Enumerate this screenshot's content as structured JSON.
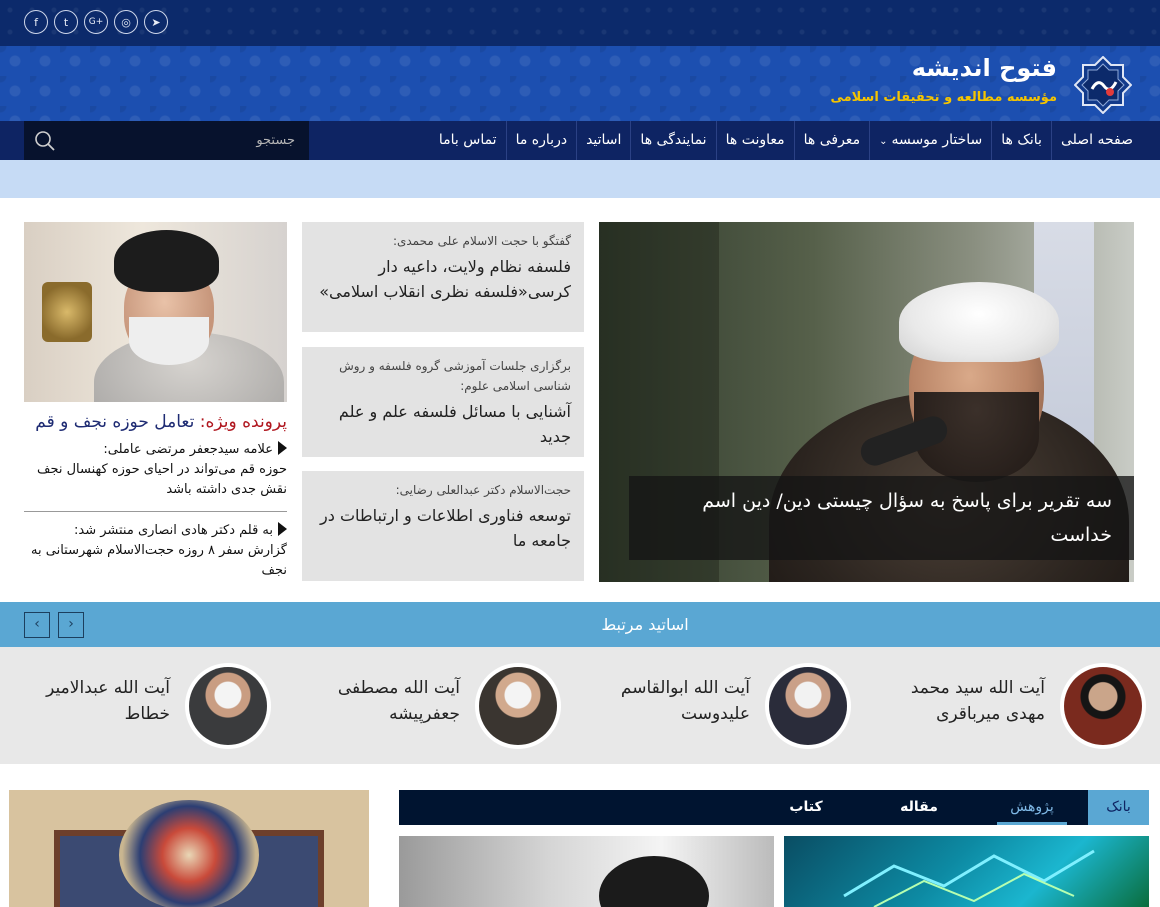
{
  "social": [
    {
      "name": "facebook-icon",
      "glyph": "f"
    },
    {
      "name": "twitter-icon",
      "glyph": "t"
    },
    {
      "name": "googleplus-icon",
      "glyph": "G+"
    },
    {
      "name": "instagram-icon",
      "glyph": "◎"
    },
    {
      "name": "telegram-icon",
      "glyph": "➤"
    }
  ],
  "header": {
    "title": "فتوح اندیشه",
    "subtitle": "مؤسسه مطالعه و تحقیقات اسلامی"
  },
  "nav": {
    "items": [
      "صفحه اصلی",
      "بانک ها",
      "ساختار موسسه",
      "معرفی ها",
      "معاونت ها",
      "نمایندگی ها",
      "اساتید",
      "درباره ما",
      "تماس باما"
    ],
    "search_placeholder": "جستجو"
  },
  "hero": {
    "caption": "سه تقریر برای پاسخ به سؤال چیستی دین/ دین اسم خداست"
  },
  "news": [
    {
      "kicker": "گفتگو با حجت الاسلام علی محمدی:",
      "title": "فلسفه نظام ولایت، داعیه دار کرسی«فلسفه نظری انقلاب اسلامی»"
    },
    {
      "kicker": "برگزاری جلسات آموزشی گروه فلسفه و روش شناسی اسلامی علوم:",
      "title": "آشنایی با مسائل فلسفه علم و علم جدید"
    },
    {
      "kicker": "حجت‌الاسلام دکتر عبدالعلی رضایی:",
      "title": "توسعه فناوری اطلاعات و ارتباطات در جامعه ما"
    }
  ],
  "special": {
    "label": "پرونده ویژه:",
    "title": "تعامل حوزه نجف و قم",
    "items": [
      {
        "lead": "علامه سیدجعفر مرتضی عاملی:",
        "text": "حوزه قم می‌تواند در احیای حوزه کهنسال نجف نقش جدی داشته باشد"
      },
      {
        "lead": "به قلم دکتر هادی انصاری منتشر شد:",
        "text": "گزارش سفر ۸ روزه حجت‌الاسلام شهرستانی به نجف"
      }
    ]
  },
  "related": {
    "title": "اساتید مرتبط",
    "prev_glyph": "‹",
    "next_glyph": "›",
    "professors": [
      "آیت الله سید محمد مهدی میرباقری",
      "آیت الله ابوالقاسم علیدوست",
      "آیت الله مصطفی جعفرپیشه",
      "آیت الله عبدالامیر خطاط"
    ]
  },
  "tabs": {
    "bank": "بانک",
    "items": [
      "پژوهش",
      "مقاله",
      "کتاب"
    ],
    "active_index": 0
  },
  "colors": {
    "nav_bg": "#0e2463",
    "accent": "#5aa7d3",
    "special_red": "#b0171f"
  }
}
